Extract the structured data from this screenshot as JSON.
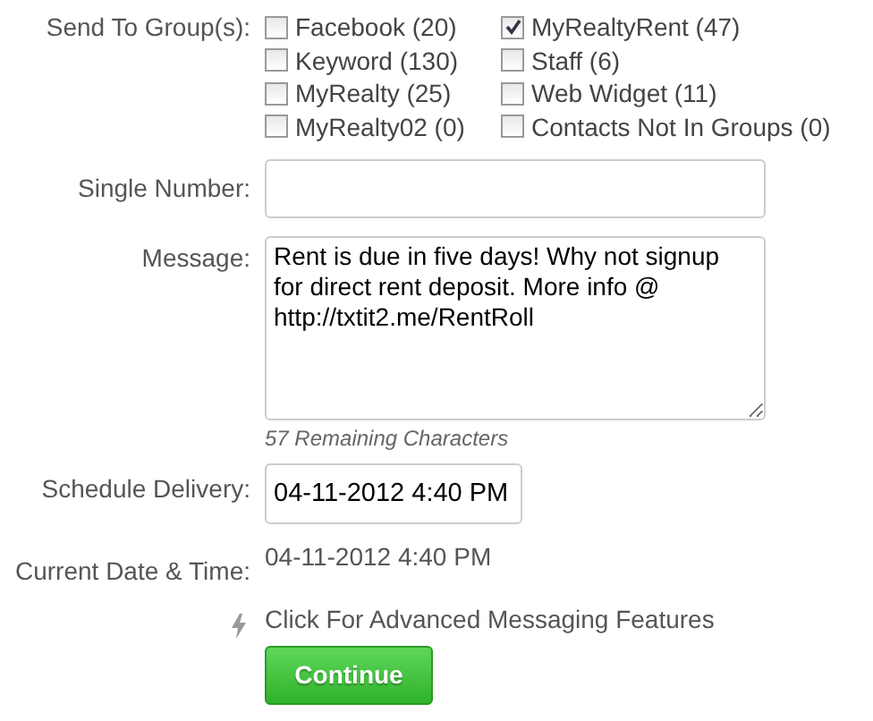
{
  "groups": {
    "label": "Send To Group(s):",
    "items": [
      {
        "label": "Facebook (20)",
        "checked": false
      },
      {
        "label": "MyRealtyRent (47)",
        "checked": true
      },
      {
        "label": "Keyword (130)",
        "checked": false
      },
      {
        "label": "Staff (6)",
        "checked": false
      },
      {
        "label": "MyRealty (25)",
        "checked": false
      },
      {
        "label": "Web Widget (11)",
        "checked": false
      },
      {
        "label": "MyRealty02 (0)",
        "checked": false
      },
      {
        "label": "Contacts Not In Groups (0)",
        "checked": false
      }
    ]
  },
  "single_number": {
    "label": "Single Number:"
  },
  "message": {
    "label": "Message:",
    "value": "Rent is due in five days! Why not signup for direct rent deposit. More info @ http://txtit2.me/RentRoll",
    "remaining": "57 Remaining Characters"
  },
  "schedule": {
    "label": "Schedule Delivery:",
    "value": "04-11-2012 4:40 PM"
  },
  "current": {
    "label": "Current Date & Time:",
    "value": "04-11-2012 4:40 PM"
  },
  "advanced_link": "Click For Advanced Messaging Features",
  "continue_button": "Continue"
}
